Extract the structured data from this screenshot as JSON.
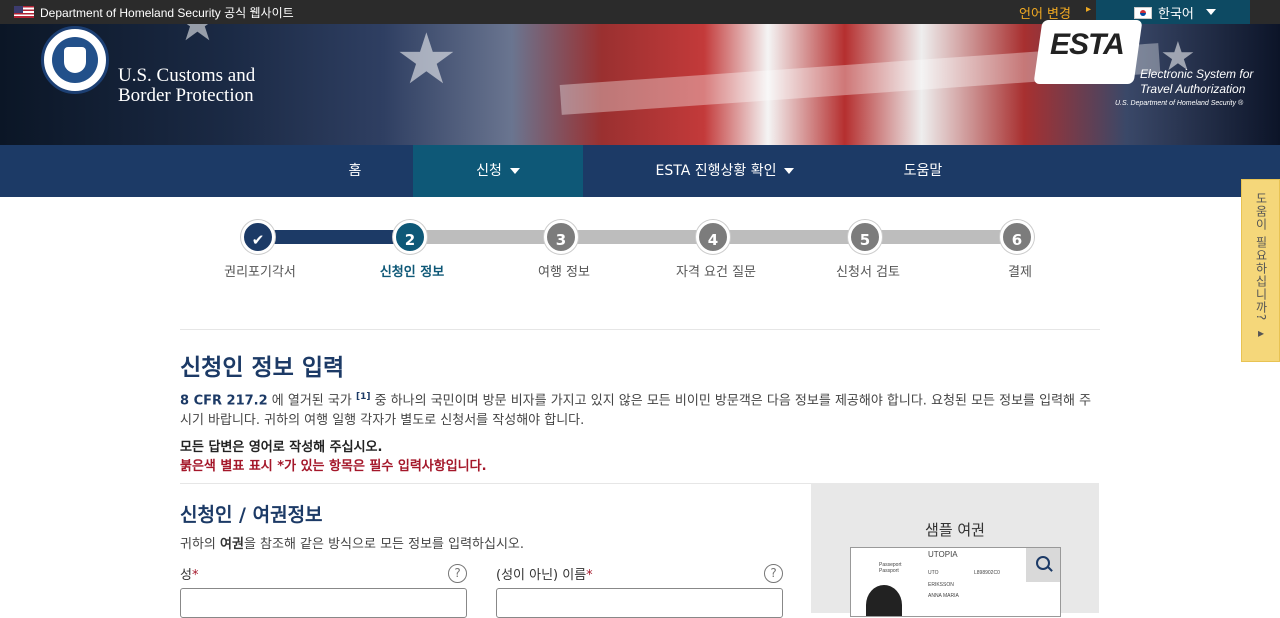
{
  "topbar": {
    "official_text": "Department of Homeland Security 공식 웹사이트",
    "language_change": "언어 변경",
    "language_selected": "한국어"
  },
  "header": {
    "agency_line1": "U.S. Customs and",
    "agency_line2": "Border Protection",
    "esta_logo": "ESTA",
    "esta_line1": "Electronic System for",
    "esta_line2": "Travel Authorization",
    "esta_dept": "U.S. Department of Homeland Security ®"
  },
  "nav": {
    "home": "홈",
    "apply": "신청",
    "status": "ESTA 진행상황 확인",
    "help": "도움말"
  },
  "steps": [
    {
      "number": "✔",
      "label": "권리포기각서"
    },
    {
      "number": "2",
      "label": "신청인 정보"
    },
    {
      "number": "3",
      "label": "여행 정보"
    },
    {
      "number": "4",
      "label": "자격 요건 질문"
    },
    {
      "number": "5",
      "label": "신청서 검토"
    },
    {
      "number": "6",
      "label": "결제"
    }
  ],
  "main": {
    "title": "신청인 정보 입력",
    "cfr": "8 CFR 217.2",
    "intro_part1": " 에 열거된 국가 ",
    "footnote": "[1]",
    "intro_part2": " 중 하나의 국민이며 방문 비자를 가지고 있지 않은 모든 비이민 방문객은 다음 정보를 제공해야 합니다. 요청된 모든 정보를 입력해 주시기 바랍니다. 귀하의 여행 일행 각자가 별도로 신청서를 작성해야 합니다.",
    "note_english": "모든 답변은 영어로 작성해 주십시오.",
    "note_required": "붉은색 별표 표시 *가 있는 항목은 필수 입력사항입니다."
  },
  "applicant_section": {
    "title": "신청인 / 여권정보",
    "desc_prefix": "귀하의 ",
    "desc_bold": "여권",
    "desc_suffix": "을 참조해 같은 방식으로 모든 정보를 입력하십시오.",
    "surname_label": "성",
    "given_name_label": "(성이 아닌) 이름",
    "required_mark": "*",
    "help_glyph": "?"
  },
  "sample_passport": {
    "title": "샘플 여권",
    "country": "UTOPIA",
    "passport_word": "Passport",
    "passport_word_fr": "Passeport",
    "code": "UTO",
    "number": "L898902C0",
    "surname": "ERIKSSON",
    "given": "ANNA MARIA"
  },
  "help_tab": {
    "label": "도움이 필요하십니까? ▸"
  },
  "colors": {
    "nav_bg": "#1c3a66",
    "nav_active": "#0e5877",
    "required_red": "#a4172a",
    "link_orange": "#f0a922",
    "help_tab_bg": "#f5d77a"
  }
}
